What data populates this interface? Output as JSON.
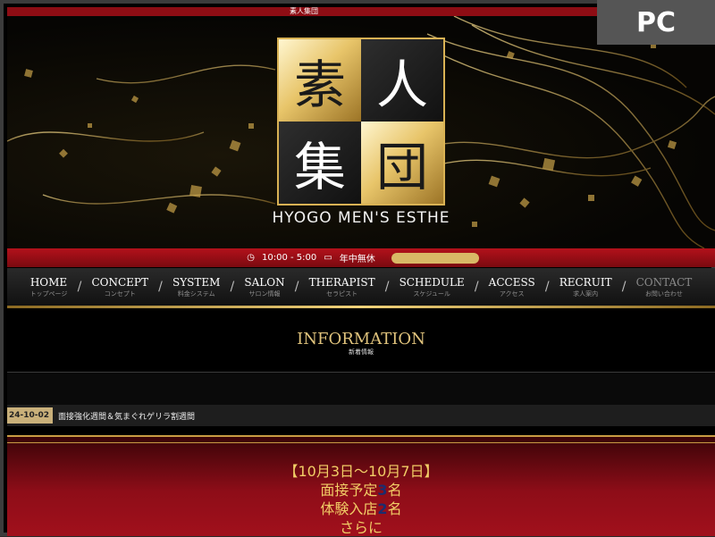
{
  "badge": "PC",
  "site": {
    "top_strip": "素人集団",
    "logo_chars": [
      "素",
      "人",
      "集",
      "団"
    ],
    "tagline": "HYOGO MEN'S ESTHE"
  },
  "hours": {
    "clock_icon": "clock-icon",
    "time": "10:00 - 5:00",
    "calendar_icon": "calendar-icon",
    "open": "年中無休"
  },
  "nav": [
    {
      "en": "HOME",
      "jp": "トップページ"
    },
    {
      "en": "CONCEPT",
      "jp": "コンセプト"
    },
    {
      "en": "SYSTEM",
      "jp": "料金システム"
    },
    {
      "en": "SALON",
      "jp": "サロン情報"
    },
    {
      "en": "THERAPIST",
      "jp": "セラピスト"
    },
    {
      "en": "SCHEDULE",
      "jp": "スケジュール"
    },
    {
      "en": "ACCESS",
      "jp": "アクセス"
    },
    {
      "en": "RECRUIT",
      "jp": "求人案内"
    },
    {
      "en": "CONTACT",
      "jp": "お問い合わせ"
    }
  ],
  "info": {
    "title": "INFORMATION",
    "subtitle": "新着情報"
  },
  "news": {
    "date": "24-10-02",
    "title": "面接強化週間＆気まぐれゲリラ割週間"
  },
  "article": {
    "line1": "【10月3日～10月7日】",
    "line2_pre": "面接予定",
    "line2_num": "3",
    "line2_post": "名",
    "line3_pre": "体験入店",
    "line3_num": "2",
    "line3_post": "名",
    "line4": "さらに"
  },
  "colors": {
    "gold": "#e0c37c",
    "red": "#8e0d14",
    "highlight": "#1c2c6e"
  }
}
